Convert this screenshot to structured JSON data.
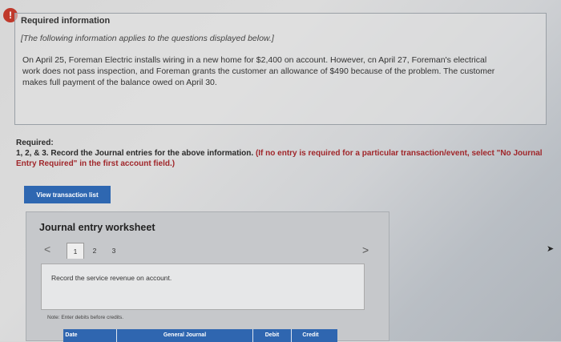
{
  "info": {
    "alert_symbol": "!",
    "title": "Required information",
    "note": "[The following information applies to the questions displayed below.]",
    "body": "On April 25, Foreman Electric installs wiring in a new home for $2,400 on account. However, cn April 27, Foreman's electrical work does not pass inspection, and Foreman grants the customer an allowance of $490 because of the problem. The customer makes full payment of the balance owed on April 30."
  },
  "required": {
    "heading": "Required:",
    "task": "1, 2, & 3. Record the Journal entries for the above information.",
    "emphasis": "(If no entry is required for a particular transaction/event, select \"No Journal Entry Required\" in the first account field.)"
  },
  "buttons": {
    "view_transactions": "View transaction list"
  },
  "worksheet": {
    "title": "Journal entry worksheet",
    "nav_prev": "<",
    "nav_next": ">",
    "tabs": [
      "1",
      "2",
      "3"
    ],
    "active_tab": 0,
    "description": "Record the service revenue on account.",
    "note": "Note: Enter debits before credits.",
    "columns": {
      "date": "Date",
      "journal": "General Journal",
      "debit": "Debit",
      "credit": "Credit"
    }
  },
  "colors": {
    "accent": "#2e67b1",
    "alert": "#c0392b",
    "emphasis": "#a0262a"
  }
}
